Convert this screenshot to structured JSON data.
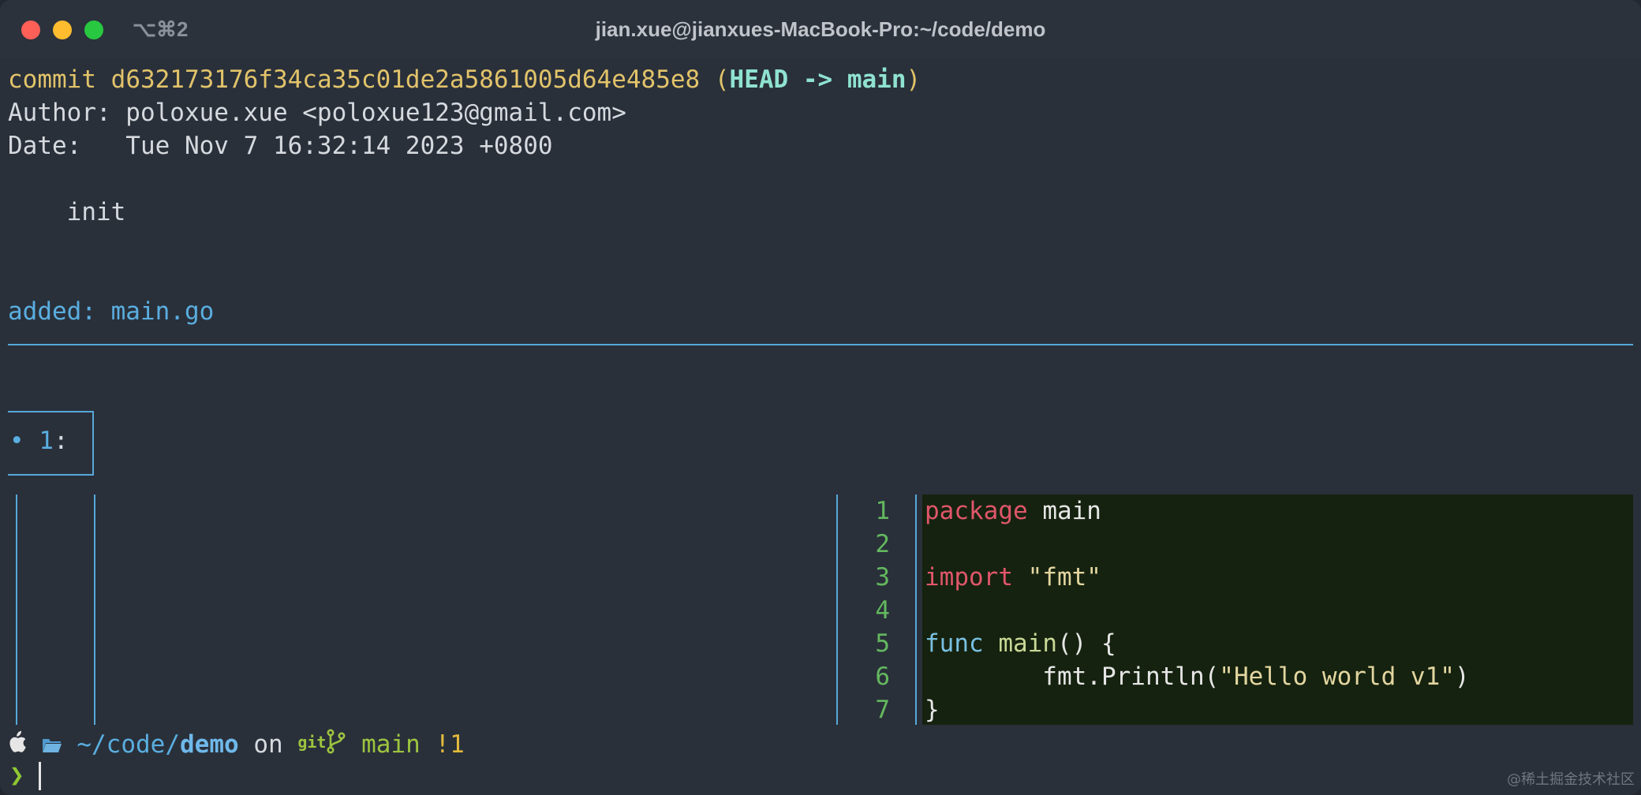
{
  "window": {
    "title": "jian.xue@jianxues-MacBook-Pro:~/code/demo",
    "shortcut": "⌥⌘2"
  },
  "commit": {
    "label": "commit",
    "hash": "d632173176f34ca35c01de2a5861005d64e485e8",
    "ref_open": "(",
    "ref": "HEAD -> main",
    "ref_close": ")",
    "author_line": "Author: poloxue.xue <poloxue123@gmail.com>",
    "date_line": "Date:   Tue Nov 7 16:32:14 2023 +0800",
    "message": "    init"
  },
  "diff": {
    "added_label": "added: main.go",
    "hunk_label": "• 1",
    "hunk_colon": ":"
  },
  "code": {
    "lines": [
      {
        "num": "1",
        "tokens": [
          {
            "t": "package",
            "c": "kw-red"
          },
          {
            "t": " main",
            "c": "plain"
          }
        ]
      },
      {
        "num": "2",
        "tokens": []
      },
      {
        "num": "3",
        "tokens": [
          {
            "t": "import",
            "c": "kw-red"
          },
          {
            "t": " ",
            "c": "plain"
          },
          {
            "t": "\"fmt\"",
            "c": "str"
          }
        ]
      },
      {
        "num": "4",
        "tokens": []
      },
      {
        "num": "5",
        "tokens": [
          {
            "t": "func",
            "c": "kw-cyan"
          },
          {
            "t": " ",
            "c": "plain"
          },
          {
            "t": "main",
            "c": "fn"
          },
          {
            "t": "() {",
            "c": "plain"
          }
        ]
      },
      {
        "num": "6",
        "tokens": [
          {
            "t": "        fmt.Println(",
            "c": "plain"
          },
          {
            "t": "\"Hello world v1\"",
            "c": "str"
          },
          {
            "t": ")",
            "c": "plain"
          }
        ]
      },
      {
        "num": "7",
        "tokens": [
          {
            "t": "}",
            "c": "plain"
          }
        ]
      }
    ]
  },
  "prompt": {
    "path_prefix": "~/code/",
    "path_dir": "demo",
    "on_word": "on",
    "git_word": "git",
    "branch": "main",
    "status": "!1",
    "chevron": "❯"
  },
  "watermark": "@稀土掘金技术社区"
}
